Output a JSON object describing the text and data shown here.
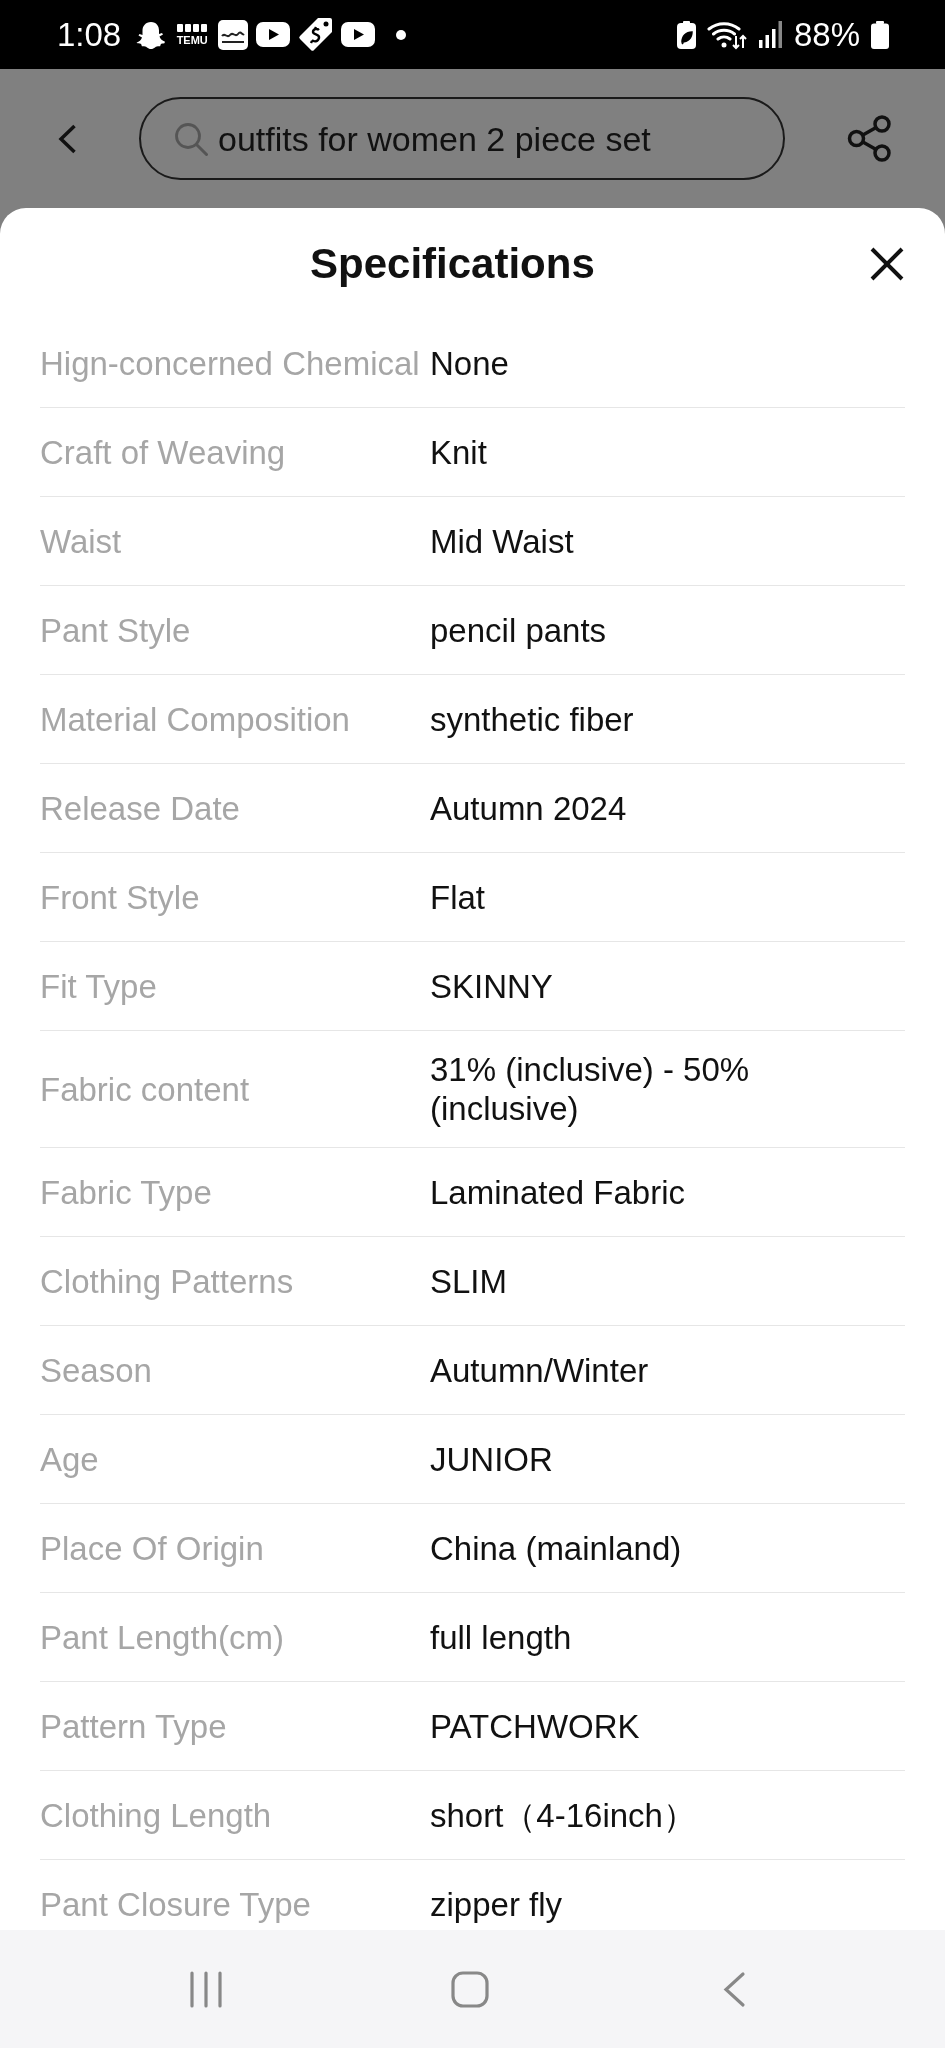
{
  "status_bar": {
    "time": "1:08",
    "app_label": "TEMU",
    "battery": "88%"
  },
  "header": {
    "search": {
      "value": "outfits for women 2 piece set"
    }
  },
  "specifications": {
    "title": "Specifications",
    "rows": [
      {
        "label": "Hign-concerned Chemical",
        "value": "None"
      },
      {
        "label": "Craft of Weaving",
        "value": "Knit"
      },
      {
        "label": "Waist",
        "value": "Mid Waist"
      },
      {
        "label": "Pant Style",
        "value": "pencil pants"
      },
      {
        "label": "Material Composition",
        "value": "synthetic fiber"
      },
      {
        "label": "Release Date",
        "value": "Autumn 2024"
      },
      {
        "label": "Front Style",
        "value": "Flat"
      },
      {
        "label": "Fit Type",
        "value": "SKINNY"
      },
      {
        "label": "Fabric content",
        "value": "31% (inclusive) - 50% (inclusive)"
      },
      {
        "label": "Fabric Type",
        "value": "Laminated Fabric"
      },
      {
        "label": "Clothing Patterns",
        "value": "SLIM"
      },
      {
        "label": "Season",
        "value": "Autumn/Winter"
      },
      {
        "label": "Age",
        "value": "JUNIOR"
      },
      {
        "label": "Place Of Origin",
        "value": "China (mainland)"
      },
      {
        "label": "Pant Length(cm)",
        "value": "full length"
      },
      {
        "label": "Pattern Type",
        "value": "PATCHWORK"
      },
      {
        "label": "Clothing Length",
        "value": "short（4-16inch）"
      },
      {
        "label": "Pant Closure Type",
        "value": "zipper fly"
      }
    ]
  }
}
